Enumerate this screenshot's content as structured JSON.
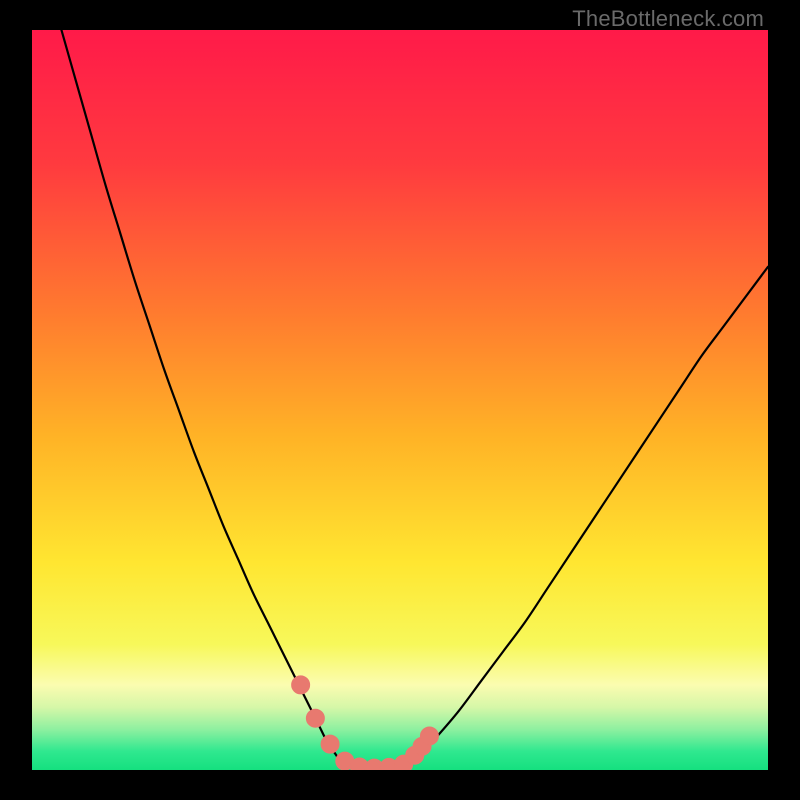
{
  "watermark": "TheBottleneck.com",
  "colors": {
    "background": "#000000",
    "gradient_stops": [
      {
        "pos": 0.0,
        "color": "#ff1a49"
      },
      {
        "pos": 0.18,
        "color": "#ff3a3f"
      },
      {
        "pos": 0.38,
        "color": "#ff7a2f"
      },
      {
        "pos": 0.55,
        "color": "#ffb326"
      },
      {
        "pos": 0.72,
        "color": "#ffe631"
      },
      {
        "pos": 0.83,
        "color": "#f7f85a"
      },
      {
        "pos": 0.885,
        "color": "#fbfcb0"
      },
      {
        "pos": 0.915,
        "color": "#d6f7a8"
      },
      {
        "pos": 0.945,
        "color": "#8ef0a0"
      },
      {
        "pos": 0.975,
        "color": "#2fe88f"
      },
      {
        "pos": 1.0,
        "color": "#15e07f"
      }
    ],
    "curve_stroke": "#000000",
    "marker_fill": "#e8796f",
    "marker_stroke": "#e8796f"
  },
  "chart_data": {
    "type": "line",
    "title": "",
    "xlabel": "",
    "ylabel": "",
    "xlim": [
      0,
      100
    ],
    "ylim": [
      0,
      100
    ],
    "series": [
      {
        "name": "left-curve",
        "x": [
          4,
          6,
          8,
          10,
          12,
          14,
          16,
          18,
          20,
          22,
          24,
          26,
          28,
          30,
          32,
          34,
          35,
          36,
          37,
          38,
          39,
          40,
          41,
          42
        ],
        "y": [
          100,
          93,
          86,
          79,
          72.5,
          66,
          60,
          54,
          48.5,
          43,
          38,
          33,
          28.5,
          24,
          20,
          16,
          14,
          12,
          10,
          8,
          6,
          4,
          2.5,
          1
        ]
      },
      {
        "name": "valley-floor",
        "x": [
          42,
          43,
          44,
          45,
          46,
          47,
          48,
          49,
          50,
          51,
          52,
          53
        ],
        "y": [
          1,
          0.6,
          0.4,
          0.3,
          0.25,
          0.25,
          0.3,
          0.4,
          0.6,
          1.0,
          1.6,
          2.4
        ]
      },
      {
        "name": "right-curve",
        "x": [
          53,
          55,
          58,
          61,
          64,
          67,
          70,
          73,
          76,
          79,
          82,
          85,
          88,
          91,
          94,
          97,
          100
        ],
        "y": [
          2.4,
          4.5,
          8,
          12,
          16,
          20,
          24.5,
          29,
          33.5,
          38,
          42.5,
          47,
          51.5,
          56,
          60,
          64,
          68
        ]
      }
    ],
    "markers": {
      "name": "valley-markers",
      "x": [
        36.5,
        38.5,
        40.5,
        42.5,
        44.5,
        46.5,
        48.5,
        50.5,
        52.0,
        53.0,
        54.0
      ],
      "y": [
        11.5,
        7.0,
        3.5,
        1.2,
        0.4,
        0.25,
        0.35,
        0.8,
        2.0,
        3.2,
        4.6
      ]
    }
  }
}
